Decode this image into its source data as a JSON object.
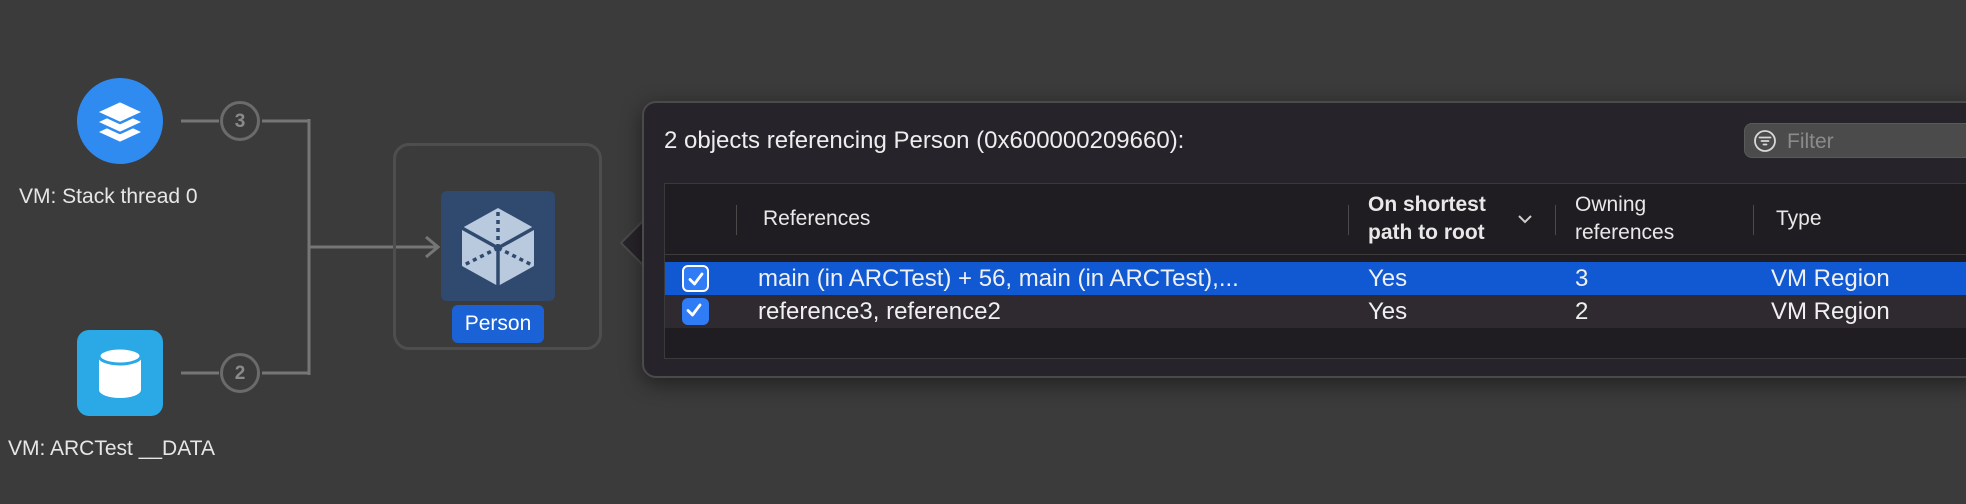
{
  "graph": {
    "nodes": [
      {
        "label": "VM: Stack thread 0",
        "icon": "stack-layers-icon",
        "color": "#2f8bf0",
        "edge_count": "3"
      },
      {
        "label": "VM: ARCTest __DATA",
        "icon": "database-icon",
        "color": "#2ba9e6",
        "edge_count": "2"
      }
    ],
    "target": {
      "label": "Person",
      "icon": "object-cube-icon"
    }
  },
  "popover": {
    "title": "2 objects referencing Person (0x600000209660):",
    "filter_placeholder": "Filter",
    "columns": {
      "references": "References",
      "shortest_line1": "On shortest",
      "shortest_line2": "path to root",
      "owning_line1": "Owning",
      "owning_line2": "references",
      "type": "Type"
    },
    "rows": [
      {
        "checked": true,
        "references": "main (in ARCTest) + 56, main (in ARCTest),...",
        "shortest": "Yes",
        "owning": "3",
        "type": "VM Region"
      },
      {
        "checked": true,
        "references": "reference3, reference2",
        "shortest": "Yes",
        "owning": "2",
        "type": "VM Region"
      }
    ]
  }
}
